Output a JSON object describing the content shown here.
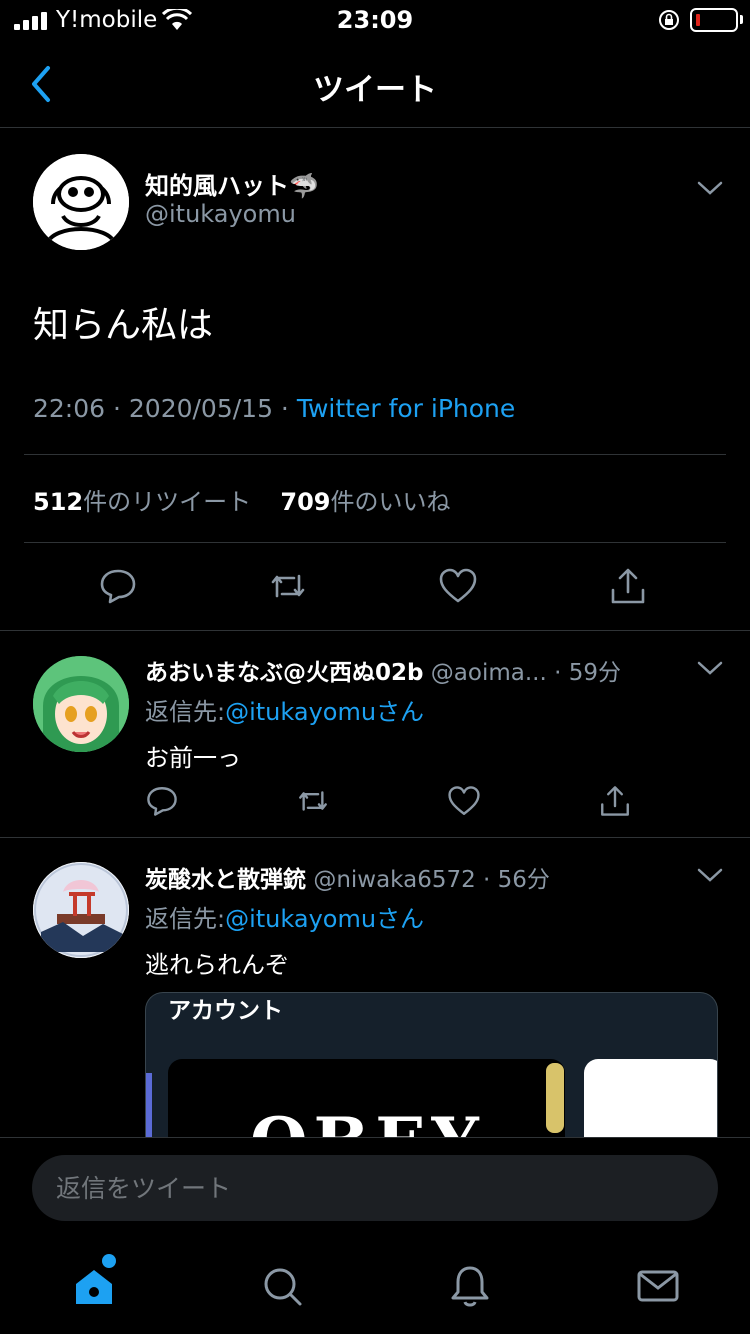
{
  "status_bar": {
    "carrier": "Y!mobile",
    "time": "23:09",
    "battery_color": "#e0241b"
  },
  "header": {
    "title": "ツイート",
    "back_icon": "chevron-left-icon"
  },
  "main_tweet": {
    "display_name": "知的風ハット🦈",
    "handle": "@itukayomu",
    "text": "知らん私は",
    "time": "22:06",
    "date": "2020/05/15",
    "source": "Twitter for iPhone",
    "retweet_count": "512",
    "retweet_label": "件のリツイート",
    "like_count": "709",
    "like_label": "件のいいね"
  },
  "replies": [
    {
      "display_name": "あおいまなぶ@火西ぬ02b",
      "handle": "@aoima...",
      "time": "· 59分",
      "reply_to_label": "返信先:",
      "reply_to_handle": "@itukayomuさん",
      "text": "お前一っ"
    },
    {
      "display_name": "炭酸水と散弾銃",
      "handle": "@niwaka6572",
      "time": "· 56分",
      "reply_to_label": "返信先:",
      "reply_to_handle": "@itukayomuさん",
      "text": "逃れられんぞ",
      "embed_title": "アカウント",
      "embed_text": "OBEY"
    }
  ],
  "reply_bar": {
    "placeholder": "返信をツイート"
  },
  "tabbar": {
    "items": [
      "home-icon",
      "search-icon",
      "notifications-icon",
      "messages-icon"
    ],
    "active_color": "#1da1f2"
  },
  "colors": {
    "accent": "#1da1f2",
    "muted": "#8b98a5",
    "divider": "#2f3336"
  }
}
